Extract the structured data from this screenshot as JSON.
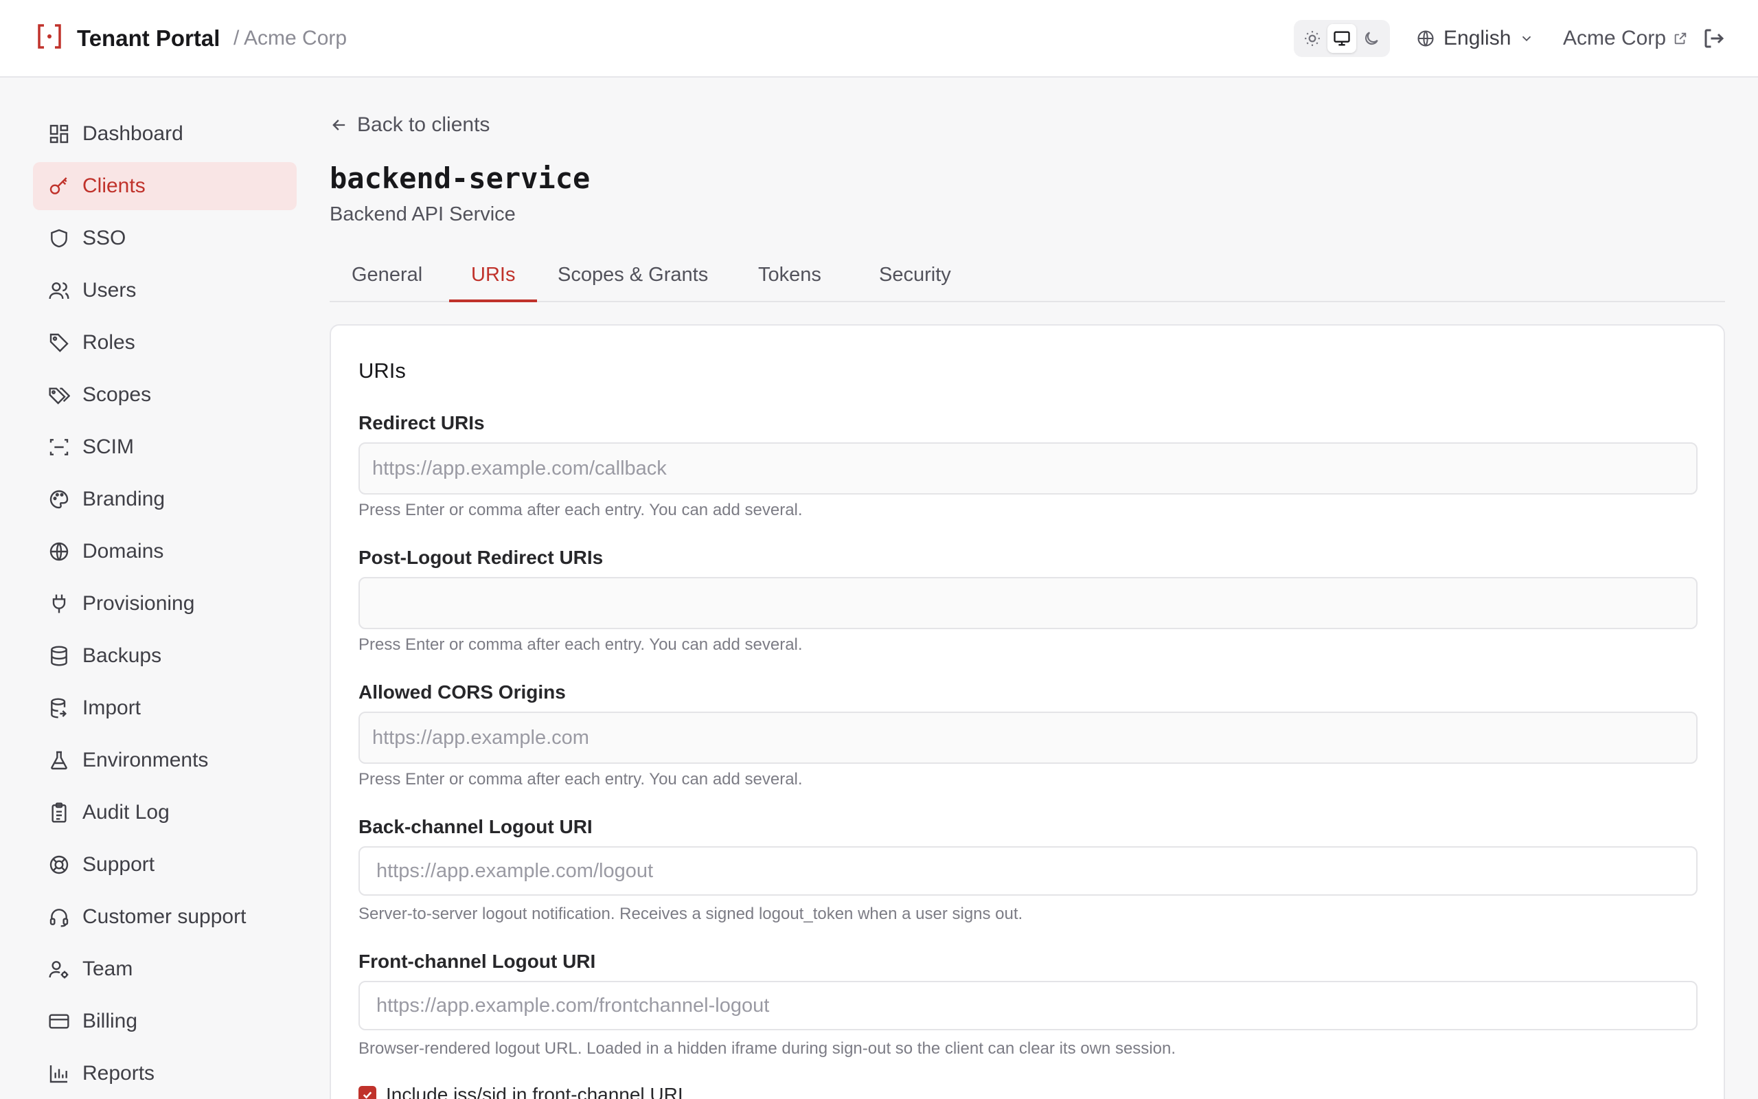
{
  "header": {
    "brand": "Tenant Portal",
    "breadcrumb": "/ Acme Corp",
    "language": "English",
    "tenant": "Acme Corp",
    "theme_active": "system"
  },
  "colors": {
    "accent": "#c0322b",
    "accent_bg": "#f9e5e5"
  },
  "sidebar": {
    "items": [
      {
        "label": "Dashboard",
        "icon": "dashboard-icon"
      },
      {
        "label": "Clients",
        "icon": "key-icon",
        "active": true
      },
      {
        "label": "SSO",
        "icon": "shield-icon"
      },
      {
        "label": "Users",
        "icon": "users-icon"
      },
      {
        "label": "Roles",
        "icon": "tag-icon"
      },
      {
        "label": "Scopes",
        "icon": "tags-icon"
      },
      {
        "label": "SCIM",
        "icon": "scan-icon"
      },
      {
        "label": "Branding",
        "icon": "palette-icon"
      },
      {
        "label": "Domains",
        "icon": "globe-icon"
      },
      {
        "label": "Provisioning",
        "icon": "plug-icon"
      },
      {
        "label": "Backups",
        "icon": "database-icon"
      },
      {
        "label": "Import",
        "icon": "database-import-icon"
      },
      {
        "label": "Environments",
        "icon": "flask-icon"
      },
      {
        "label": "Audit Log",
        "icon": "clipboard-icon"
      },
      {
        "label": "Support",
        "icon": "lifebuoy-icon"
      },
      {
        "label": "Customer support",
        "icon": "headset-icon"
      },
      {
        "label": "Team",
        "icon": "user-cog-icon"
      },
      {
        "label": "Billing",
        "icon": "credit-card-icon"
      },
      {
        "label": "Reports",
        "icon": "bar-chart-icon"
      }
    ]
  },
  "main": {
    "back_label": "Back to clients",
    "title": "backend-service",
    "subtitle": "Backend API Service",
    "tabs": [
      {
        "label": "General"
      },
      {
        "label": "URIs",
        "active": true
      },
      {
        "label": "Scopes & Grants"
      },
      {
        "label": "Tokens"
      },
      {
        "label": "Security"
      }
    ],
    "card": {
      "title": "URIs",
      "redirect": {
        "label": "Redirect URIs",
        "placeholder": "https://app.example.com/callback",
        "help": "Press Enter or comma after each entry. You can add several."
      },
      "post_logout": {
        "label": "Post-Logout Redirect URIs",
        "placeholder": "",
        "help": "Press Enter or comma after each entry. You can add several."
      },
      "cors": {
        "label": "Allowed CORS Origins",
        "placeholder": "https://app.example.com",
        "help": "Press Enter or comma after each entry. You can add several."
      },
      "backchannel": {
        "label": "Back-channel Logout URI",
        "placeholder": "https://app.example.com/logout",
        "help": "Server-to-server logout notification. Receives a signed logout_token when a user signs out."
      },
      "frontchannel": {
        "label": "Front-channel Logout URI",
        "placeholder": "https://app.example.com/frontchannel-logout",
        "help": "Browser-rendered logout URL. Loaded in a hidden iframe during sign-out so the client can clear its own session."
      },
      "include_iss_sid": {
        "label": "Include iss/sid in front-channel URI",
        "checked": true
      }
    }
  }
}
